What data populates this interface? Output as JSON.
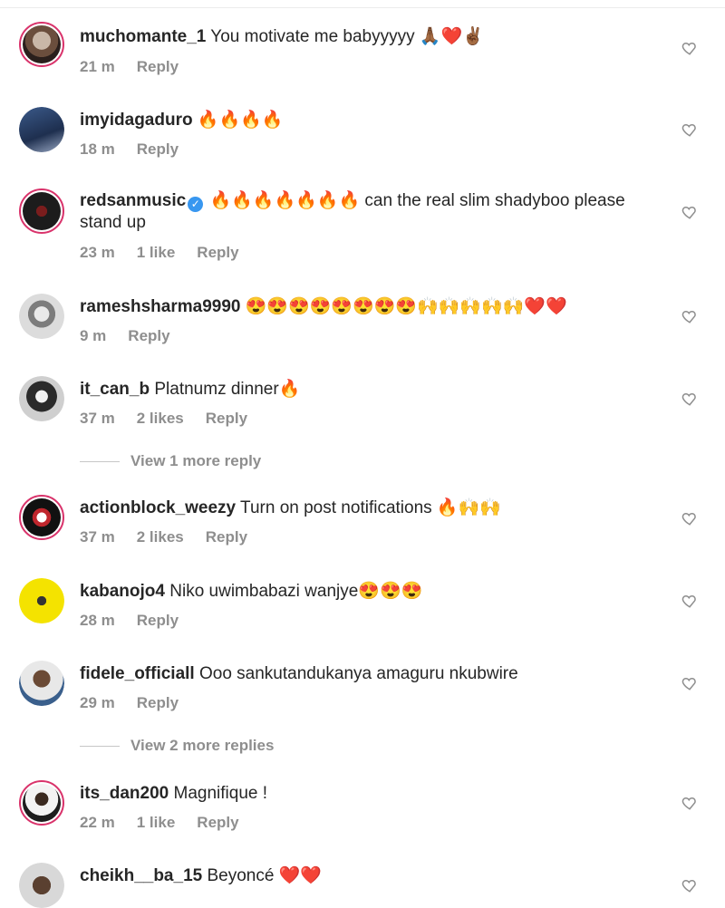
{
  "comments": [
    {
      "user": "muchomante_1",
      "text": " You motivate me babyyyyy 🙏🏾❤️✌🏾",
      "time": "21 m",
      "likes": "",
      "reply": "Reply",
      "verified": false
    },
    {
      "user": "imyidagaduro",
      "text": " 🔥🔥🔥🔥",
      "time": "18 m",
      "likes": "",
      "reply": "Reply",
      "verified": false
    },
    {
      "user": "redsanmusic",
      "text": " 🔥🔥🔥🔥🔥🔥🔥 can the real slim shadyboo please stand up",
      "time": "23 m",
      "likes": "1 like",
      "reply": "Reply",
      "verified": true
    },
    {
      "user": "rameshsharma9990",
      "text": " 😍😍😍😍😍😍😍😍🙌🙌🙌🙌🙌❤️❤️",
      "time": "9 m",
      "likes": "",
      "reply": "Reply",
      "verified": false
    },
    {
      "user": "it_can_b",
      "text": " Platnumz dinner🔥",
      "time": "37 m",
      "likes": "2 likes",
      "reply": "Reply",
      "verified": false
    },
    {
      "user": "actionblock_weezy",
      "text": " Turn on post notifications 🔥🙌🙌",
      "time": "37 m",
      "likes": "2 likes",
      "reply": "Reply",
      "verified": false
    },
    {
      "user": "kabanojo4",
      "text": " Niko uwimbabazi wanjye😍😍😍",
      "time": "28 m",
      "likes": "",
      "reply": "Reply",
      "verified": false
    },
    {
      "user": "fidele_officiall",
      "text": " Ooo sankutandukanya amaguru nkubwire",
      "time": "29 m",
      "likes": "",
      "reply": "Reply",
      "verified": false
    },
    {
      "user": "its_dan200",
      "text": " Magnifique !",
      "time": "22 m",
      "likes": "1 like",
      "reply": "Reply",
      "verified": false
    },
    {
      "user": "cheikh__ba_15",
      "text": " Beyoncé ❤️❤️",
      "time": "",
      "likes": "",
      "reply": "",
      "verified": false
    }
  ],
  "view_more": [
    "View 1 more reply",
    "View 2 more replies"
  ],
  "verified_mark": "✓",
  "colors": {
    "ring": "#d9336b",
    "meta": "#8e8e8e",
    "text": "#262626",
    "verified": "#3897f0"
  }
}
